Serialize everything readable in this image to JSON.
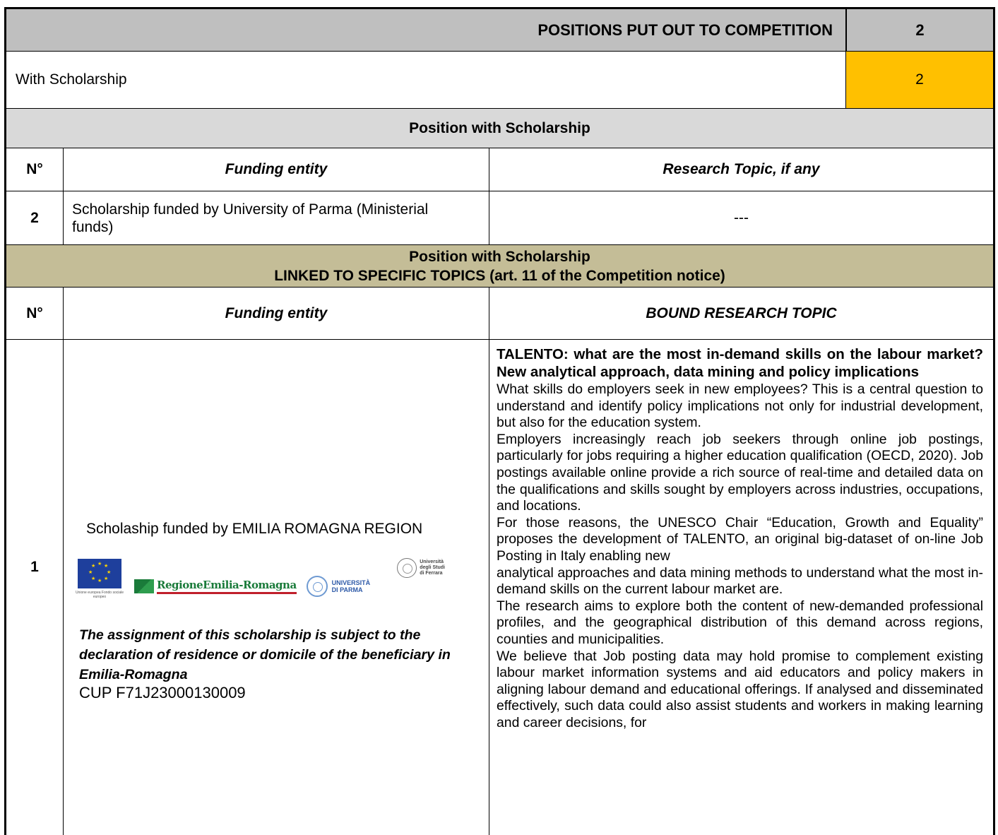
{
  "header": {
    "title": "POSITIONS PUT OUT TO COMPETITION",
    "total": "2"
  },
  "with_scholarship": {
    "label": "With Scholarship",
    "count": "2"
  },
  "section_standard": {
    "title": "Position with Scholarship",
    "col_n": "N°",
    "col_funding": "Funding entity",
    "col_topic": "Research Topic, if any",
    "rows": [
      {
        "n": "2",
        "funding": "Scholarship funded by University of Parma (Ministerial funds)",
        "topic": "---"
      }
    ]
  },
  "section_linked": {
    "title_line1": "Position with Scholarship",
    "title_line2": "LINKED TO SPECIFIC TOPICS (art. 11 of the Competition notice)",
    "col_n": "N°",
    "col_funding": "Funding entity",
    "col_topic": "BOUND RESEARCH TOPIC",
    "row": {
      "n": "1",
      "funding_title": "Scholaship funded by EMILIA ROMAGNA REGION",
      "logos": {
        "eu_caption": "Unione europea Fondo sociale europeo",
        "rer": "RegioneEmilia-Romagna",
        "unipr_line1": "UNIVERSITÀ",
        "unipr_line2": "DI PARMA",
        "unife_line1": "Università",
        "unife_line2": "degli Studi",
        "unife_line3": "di Ferrara"
      },
      "note": "The assignment of this scholarship is subject to the declaration of residence or domicile of the beneficiary in Emilia-Romagna",
      "cup": "CUP F71J23000130009",
      "topic_title": "TALENTO: what are the most in-demand skills on the labour market? New analytical approach, data mining and policy implications",
      "paragraphs": [
        "What skills do employers seek in new employees? This is a central question to understand and identify policy implications not only for industrial development, but also for the education system.",
        "Employers increasingly reach job seekers through online job postings, particularly for jobs requiring a higher education qualification (OECD, 2020). Job postings available online provide a rich source of real-time and detailed data on the qualifications and skills sought by employers across industries, occupations, and locations.",
        "For those reasons, the UNESCO Chair “Education, Growth and Equality” proposes the development of TALENTO, an original big-dataset of on-line Job Posting in Italy enabling new",
        "analytical approaches and data mining methods to understand what the most in-demand skills on the current labour market are.",
        "The research aims to explore both the content of new-demanded professional profiles, and the geographical distribution of this demand across regions, counties and municipalities.",
        "We believe that Job posting data may hold promise to complement existing labour market information systems and aid educators and policy makers in aligning labour demand and educational offerings. If analysed and disseminated effectively, such data could also assist students and workers in making learning and career decisions, for"
      ]
    }
  }
}
